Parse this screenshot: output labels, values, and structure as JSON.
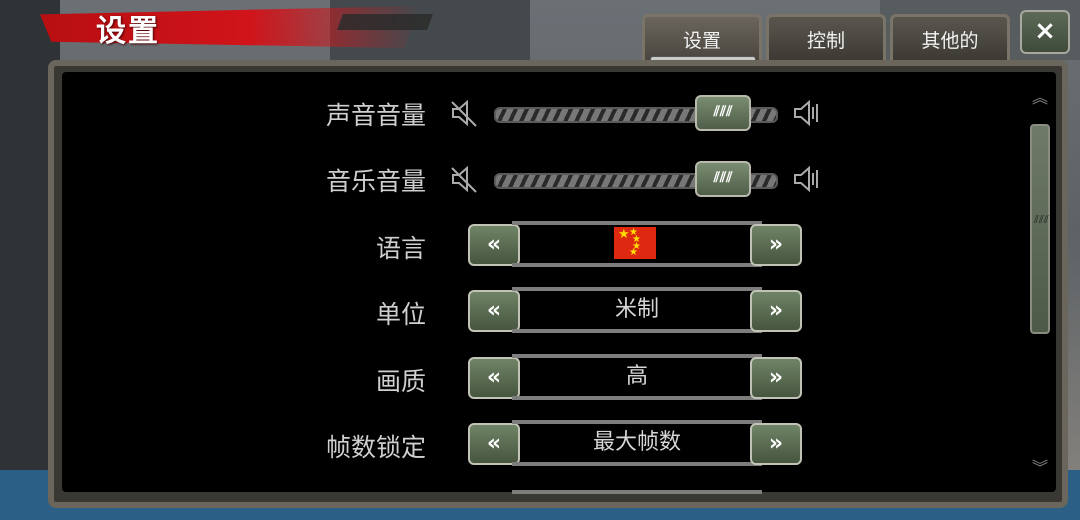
{
  "header": {
    "title": "设置"
  },
  "tabs": [
    {
      "label": "设置",
      "active": true
    },
    {
      "label": "控制",
      "active": false
    },
    {
      "label": "其他的",
      "active": false
    }
  ],
  "close_icon": "×",
  "settings": {
    "sound_volume": {
      "label": "声音音量",
      "value": 0.88
    },
    "music_volume": {
      "label": "音乐音量",
      "value": 0.88
    },
    "language": {
      "label": "语言",
      "value_icon": "china-flag"
    },
    "units": {
      "label": "单位",
      "value": "米制"
    },
    "quality": {
      "label": "画质",
      "value": "高"
    },
    "fps_lock": {
      "label": "帧数锁定",
      "value": "最大帧数"
    }
  },
  "arrows": {
    "left": "«",
    "right": "»"
  },
  "knob_glyph": "⫽⫽⫽",
  "scroll": {
    "up": "︽",
    "down": "︾",
    "grip": "⫽⫽⫽"
  },
  "colors": {
    "accent_red": "#d0141a",
    "button_green": "#5d6f55",
    "panel_bg": "#000000"
  }
}
